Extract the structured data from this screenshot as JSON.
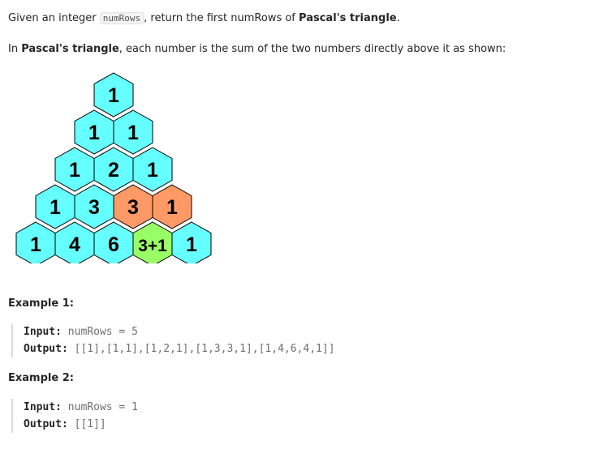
{
  "intro": {
    "p1_prefix": "Given an integer ",
    "p1_code": "numRows",
    "p1_mid": ", return the first numRows of ",
    "p1_bold": "Pascal's triangle",
    "p1_suffix": ".",
    "p2_prefix": "In ",
    "p2_bold": "Pascal's triangle",
    "p2_suffix": ", each number is the sum of the two numbers directly above it as shown:"
  },
  "triangle": {
    "rows": [
      [
        {
          "label": "1",
          "color": "#66ffff"
        }
      ],
      [
        {
          "label": "1",
          "color": "#66ffff"
        },
        {
          "label": "1",
          "color": "#66ffff"
        }
      ],
      [
        {
          "label": "1",
          "color": "#66ffff"
        },
        {
          "label": "2",
          "color": "#66ffff"
        },
        {
          "label": "1",
          "color": "#66ffff"
        }
      ],
      [
        {
          "label": "1",
          "color": "#66ffff"
        },
        {
          "label": "3",
          "color": "#66ffff"
        },
        {
          "label": "3",
          "color": "#ff9966"
        },
        {
          "label": "1",
          "color": "#ff9966"
        }
      ],
      [
        {
          "label": "1",
          "color": "#66ffff"
        },
        {
          "label": "4",
          "color": "#66ffff"
        },
        {
          "label": "6",
          "color": "#66ffff"
        },
        {
          "label": "3+1",
          "color": "#99ff66"
        },
        {
          "label": "1",
          "color": "#66ffff"
        }
      ]
    ]
  },
  "examples": [
    {
      "title": "Example 1:",
      "input_label": "Input:",
      "input_value": "numRows = 5",
      "output_label": "Output:",
      "output_value": "[[1],[1,1],[1,2,1],[1,3,3,1],[1,4,6,4,1]]"
    },
    {
      "title": "Example 2:",
      "input_label": "Input:",
      "input_value": "numRows = 1",
      "output_label": "Output:",
      "output_value": "[[1]]"
    }
  ]
}
